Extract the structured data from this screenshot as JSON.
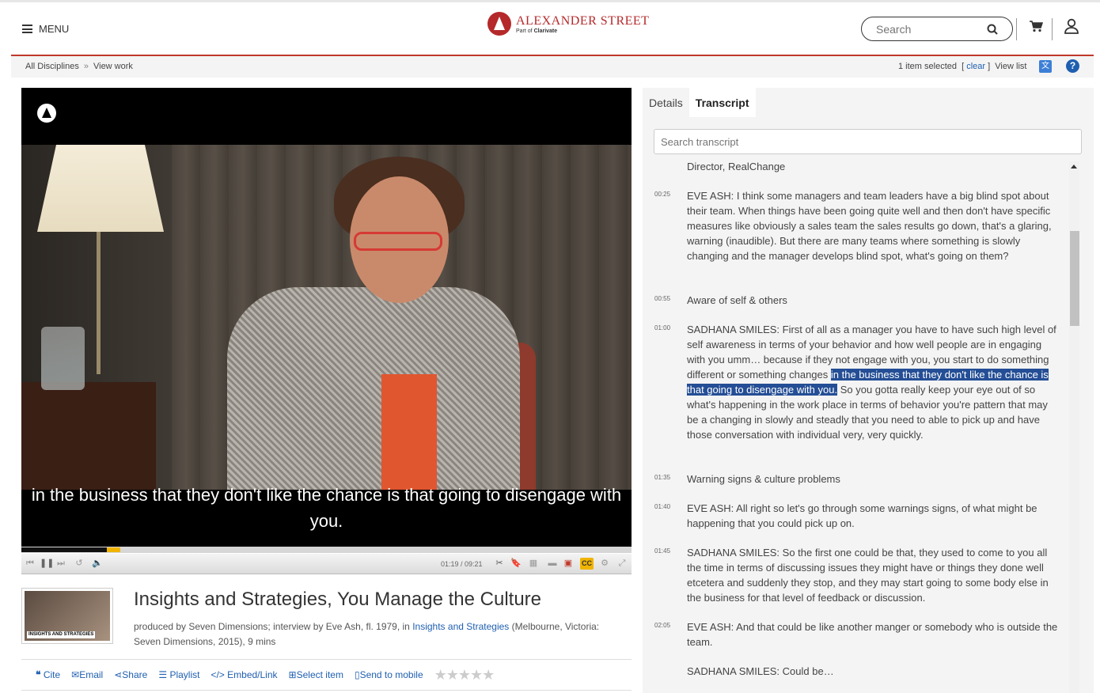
{
  "header": {
    "menu_label": "MENU",
    "logo_name": "ALEXANDER STREET",
    "logo_sub_prefix": "Part of ",
    "logo_sub_brand": "Clarivate",
    "search_placeholder": "Search"
  },
  "subbar": {
    "crumbs": [
      "All Disciplines",
      "View work"
    ],
    "crumb_sep": "»",
    "selected_text": "1 item selected",
    "clear_label": "clear",
    "view_list_label": "View list"
  },
  "video": {
    "caption": "in the business that they don't like the chance is that going to disengage with you.",
    "time": "01:19 / 09:21",
    "progress_fraction": 0.14,
    "buffer_fraction": 0.162,
    "cc_label": "CC"
  },
  "work": {
    "thumb_label": "INSIGHTS AND STRATEGIES",
    "title": "Insights and Strategies, You Manage the Culture",
    "meta_prefix": "produced by Seven Dimensions; interview by Eve Ash, fl. 1979, in ",
    "meta_link": "Insights and Strategies",
    "meta_suffix": " (Melbourne, Victoria: Seven Dimensions, 2015), 9 mins"
  },
  "actions": {
    "cite": "Cite",
    "email": "Email",
    "share": "Share",
    "playlist": "Playlist",
    "embed": "Embed/Link",
    "select": "Select item",
    "send": "Send to mobile",
    "rating_stars": 0
  },
  "panel": {
    "tabs": [
      "Details",
      "Transcript"
    ],
    "search_placeholder": "Search transcript",
    "entries": [
      {
        "time": "",
        "text": "Director, RealChange"
      },
      {
        "time": "00:25",
        "text": "EVE ASH: I think some managers and team leaders have a big blind spot about their team. When things have been going quite well and then don't have specific measures like obviously a sales team the sales results go down, that's a glaring, warning (inaudible). But there are many teams where something is slowly changing and the manager develops blind spot, what's going on them?"
      },
      {
        "time": "00:55",
        "text": "Aware of self & others"
      },
      {
        "time": "01:00",
        "text_before": "SADHANA SMILES: First of all as a manager you have to have such high level of self awareness in terms of your behavior and how well people are in engaging with you umm… because if they not engage with you, you start to do something different or something changes ",
        "text_highlight": "in the business that they don't like the chance is that going to disengage with you.",
        "text_after": " So you gotta really keep your eye out of so what's happening in the work place in terms of behavior you're pattern that may be a changing in slowly and steadly that you need to able to pick up and have those conversation with individual very, very quickly."
      },
      {
        "time": "01:35",
        "text": "Warning signs & culture problems"
      },
      {
        "time": "01:40",
        "text": "EVE ASH: All right so let's go through some warnings signs, of what might be happening that you could pick up on."
      },
      {
        "time": "01:45",
        "text": "SADHANA SMILES: So the first one could be that, they used to come to you all the time in terms of discussing issues they might have or things they done well etcetera and suddenly they stop, and they may start going to some body else in the business for that level of feedback or discussion."
      },
      {
        "time": "02:05",
        "text": "EVE ASH: And that could be like another manger or somebody who is outside the team."
      },
      {
        "time": "",
        "text": "SADHANA SMILES: Could be…"
      }
    ]
  }
}
